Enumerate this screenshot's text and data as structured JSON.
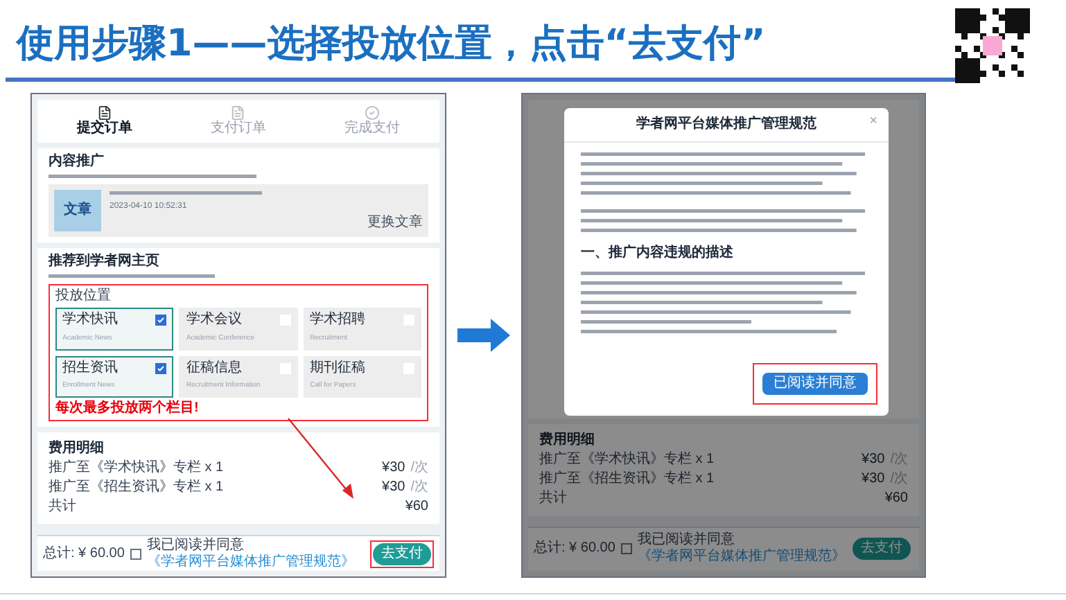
{
  "title": "使用步骤1——选择投放位置，点击“去支付”",
  "left": {
    "steps": [
      {
        "label": "提交订单",
        "selected": true
      },
      {
        "label": "支付订单",
        "selected": false
      },
      {
        "label": "完成支付",
        "selected": false
      }
    ],
    "content": {
      "heading": "内容推广",
      "thumb": "文章",
      "date": "2023-04-10 10:52:31",
      "change": "更换文章"
    },
    "recommend": {
      "heading": "推荐到学者网主页",
      "position_label": "投放位置",
      "options": [
        {
          "name": "学术快讯",
          "en": "Academic News",
          "checked": true
        },
        {
          "name": "学术会议",
          "en": "Academic Conference",
          "checked": false
        },
        {
          "name": "学术招聘",
          "en": "Recruitment",
          "checked": false
        },
        {
          "name": "招生资讯",
          "en": "Enrollment News",
          "checked": true
        },
        {
          "name": "征稿信息",
          "en": "Recruitment Information",
          "checked": false
        },
        {
          "name": "期刊征稿",
          "en": "Call for Papers",
          "checked": false
        }
      ],
      "warning": "每次最多投放两个栏目!"
    },
    "fees": {
      "heading": "费用明细",
      "items": [
        {
          "label": "推广至《学术快讯》专栏 x 1",
          "price": "¥30",
          "unit": "/次"
        },
        {
          "label": "推广至《招生资讯》专栏 x 1",
          "price": "¥30",
          "unit": "/次"
        }
      ],
      "total_label": "共计",
      "total": "¥60"
    },
    "footer": {
      "total": "总计: ¥ 60.00",
      "agree_checked": false,
      "agree": "我已阅读并同意",
      "link": "《学者网平台媒体推广管理规范》",
      "pay": "去支付"
    }
  },
  "right": {
    "fees": {
      "heading": "费用明细",
      "items": [
        {
          "label": "推广至《学术快讯》专栏 x 1",
          "price": "¥30",
          "unit": "/次"
        },
        {
          "label": "推广至《招生资讯》专栏 x 1",
          "price": "¥30",
          "unit": "/次"
        }
      ],
      "total_label": "共计",
      "total": "¥60"
    },
    "footer": {
      "total": "总计: ¥ 60.00",
      "agree_checked": false,
      "agree": "我已阅读并同意",
      "link": "《学者网平台媒体推广管理规范》",
      "pay": "去支付"
    },
    "modal": {
      "title": "学者网平台媒体推广管理规范",
      "close": "×",
      "section": "一、推广内容违规的描述",
      "accept": "已阅读并同意"
    }
  }
}
